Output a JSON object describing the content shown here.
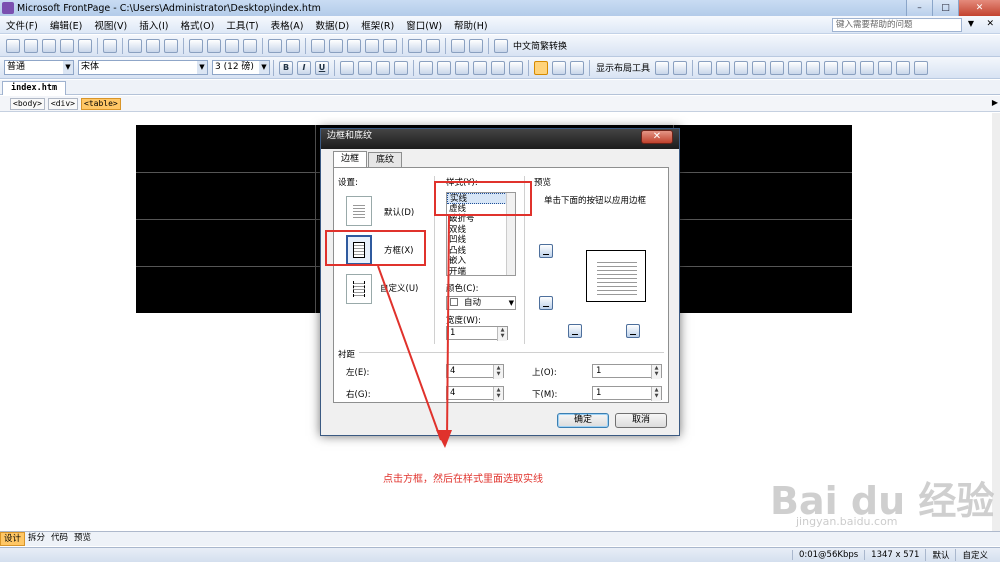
{
  "window": {
    "title": "Microsoft FrontPage - C:\\Users\\Administrator\\Desktop\\index.htm",
    "help_placeholder": "键入需要帮助的问题",
    "minimize": "–",
    "maximize": "□",
    "close": "✕"
  },
  "menu": [
    "文件(F)",
    "编辑(E)",
    "视图(V)",
    "插入(I)",
    "格式(O)",
    "工具(T)",
    "表格(A)",
    "数据(D)",
    "框架(R)",
    "窗口(W)",
    "帮助(H)"
  ],
  "toolbar": {
    "convert_label": "中文简繁转换",
    "style_value": "普通",
    "font_value": "宋体",
    "size_value": "3 (12 磅)",
    "bold": "B",
    "italic": "I",
    "underline": "U",
    "layout_tools": "显示布局工具"
  },
  "document": {
    "tab": "index.htm",
    "tags": [
      "<body>",
      "<div>",
      "<table>"
    ]
  },
  "dialog": {
    "title": "边框和底纹",
    "close": "✕",
    "tabs": [
      "边框",
      "底纹"
    ],
    "setting_label": "设置:",
    "settings": [
      "默认(D)",
      "方框(X)",
      "自定义(U)"
    ],
    "style_label": "样式(Y):",
    "styles": [
      "实线",
      "虚线",
      "破折号",
      "双线",
      "凹线",
      "凸线",
      "嵌入",
      "开端"
    ],
    "selected_style": "实线",
    "color_label": "颜色(C):",
    "color_value": "自动",
    "width_label": "宽度(W):",
    "width_value": "1",
    "preview_label": "预览",
    "preview_hint": "单击下面的按钮以应用边框",
    "padding_label": "衬距",
    "left_label": "左(E):",
    "left_value": "4",
    "right_label": "右(G):",
    "right_value": "4",
    "top_label": "上(O):",
    "top_value": "1",
    "bottom_label": "下(M):",
    "bottom_value": "1",
    "ok": "确定",
    "cancel": "取消"
  },
  "annotation": {
    "text": "点击方框，然后在样式里面选取实线",
    "color": "#e0322c"
  },
  "watermark": {
    "brand": "Bai du 经验",
    "url": "jingyan.baidu.com"
  },
  "views": [
    "设计",
    "拆分",
    "代码",
    "预览"
  ],
  "status": [
    "0:01@56Kbps",
    "1347 x 571",
    "默认",
    "自定义"
  ]
}
